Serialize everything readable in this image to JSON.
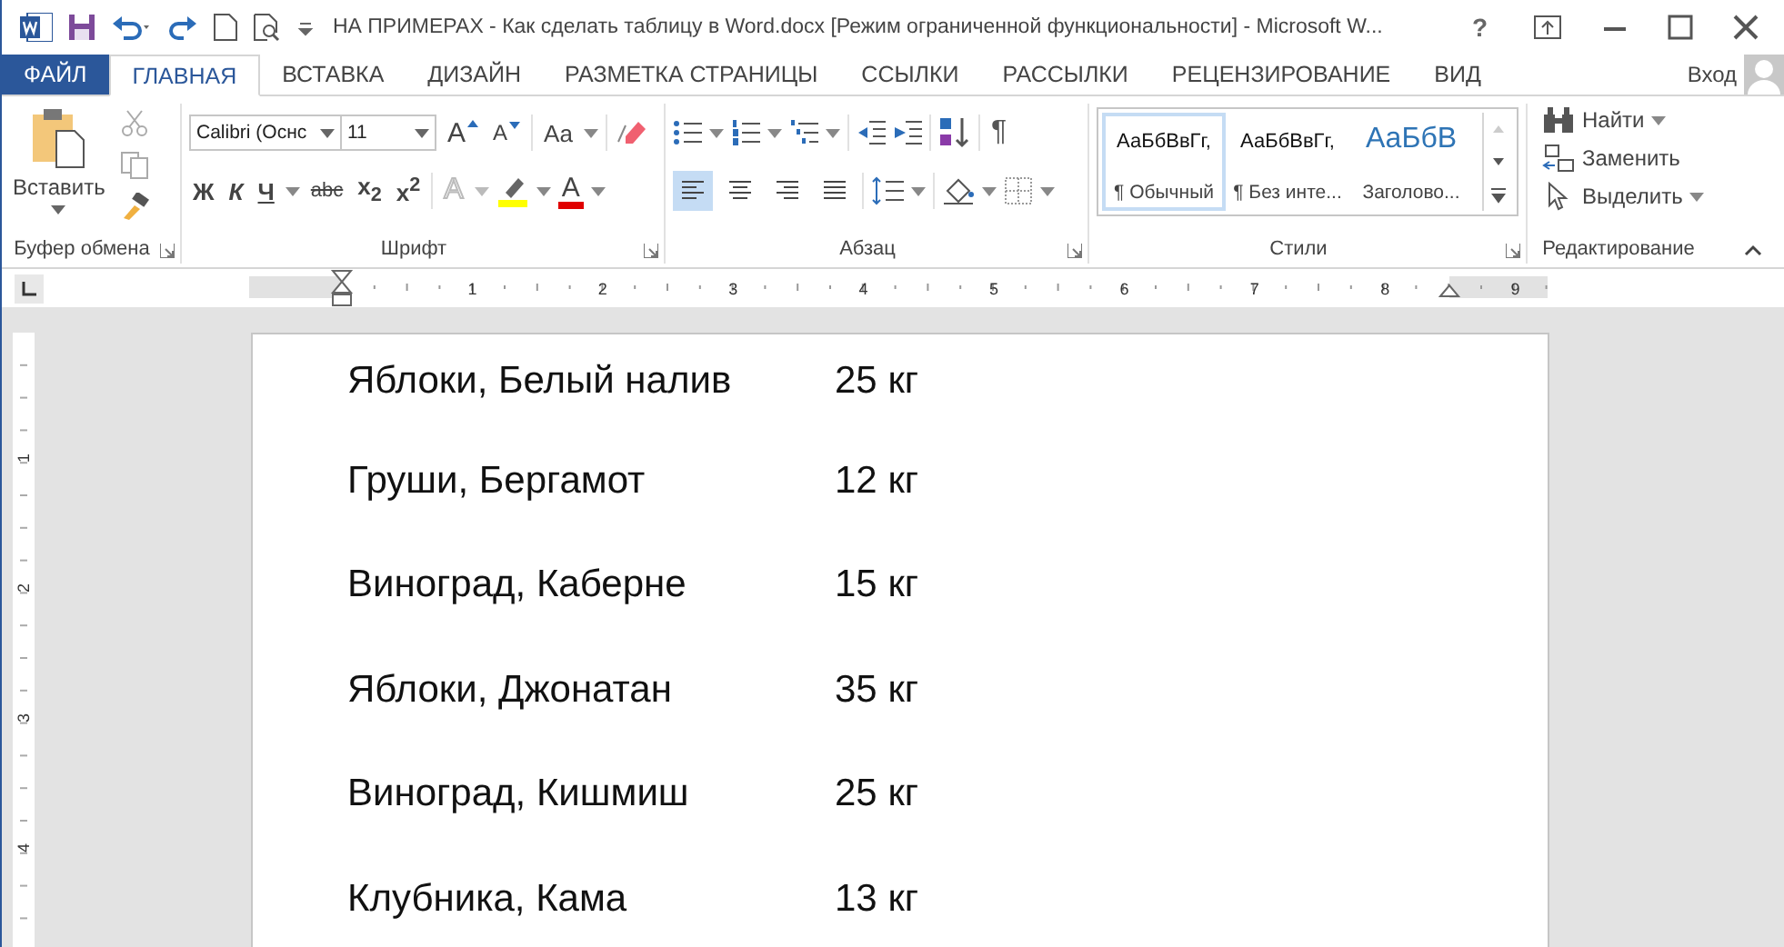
{
  "title_bar": {
    "title": "НА ПРИМЕРАХ - Как сделать таблицу в Word.docx [Режим ограниченной функциональности] - Microsoft W...",
    "help": "?"
  },
  "tabs": [
    {
      "label": "ФАЙЛ",
      "kind": "file",
      "selected": false
    },
    {
      "label": "ГЛАВНАЯ",
      "kind": "tab",
      "selected": true
    },
    {
      "label": "ВСТАВКА",
      "kind": "tab",
      "selected": false
    },
    {
      "label": "ДИЗАЙН",
      "kind": "tab",
      "selected": false
    },
    {
      "label": "РАЗМЕТКА СТРАНИЦЫ",
      "kind": "tab",
      "selected": false
    },
    {
      "label": "ССЫЛКИ",
      "kind": "tab",
      "selected": false
    },
    {
      "label": "РАССЫЛКИ",
      "kind": "tab",
      "selected": false
    },
    {
      "label": "РЕЦЕНЗИРОВАНИЕ",
      "kind": "tab",
      "selected": false
    },
    {
      "label": "ВИД",
      "kind": "tab",
      "selected": false
    }
  ],
  "account": {
    "label": "Вход"
  },
  "clipboard": {
    "paste": "Вставить",
    "label": "Буфер обмена"
  },
  "font": {
    "name": "Calibri (Оснс",
    "size": "11",
    "grow": "A",
    "shrink": "A",
    "case": "Aa",
    "bold": "Ж",
    "italic": "К",
    "underline": "Ч",
    "strike": "abc",
    "subscript": "x$_{2}$",
    "superscript": "x$^{2}$",
    "effects": "A",
    "color_letter": "A",
    "label": "Шрифт"
  },
  "paragraph": {
    "pilcrow": "¶",
    "alignments": [
      {
        "kind": "left",
        "selected": true
      },
      {
        "kind": "center",
        "selected": false
      },
      {
        "kind": "right",
        "selected": false
      },
      {
        "kind": "justify",
        "selected": false
      }
    ],
    "label": "Абзац"
  },
  "styles": {
    "items": [
      {
        "preview": "АаБбВвГг,",
        "name": "¶ Обычный",
        "kind": "normal",
        "selected": true
      },
      {
        "preview": "АаБбВвГг,",
        "name": "¶ Без инте...",
        "kind": "normal",
        "selected": false
      },
      {
        "preview": "АаБбВ",
        "name": "Заголово...",
        "kind": "heading",
        "selected": false
      }
    ],
    "label": "Стили"
  },
  "editing": {
    "items": [
      {
        "kind": "find",
        "label": "Найти"
      },
      {
        "kind": "replace",
        "label": "Заменить"
      },
      {
        "kind": "select",
        "label": "Выделить"
      }
    ],
    "label": "Редактирование"
  },
  "ruler": {
    "numbers": [
      "1",
      "2",
      "3",
      "4",
      "5",
      "6",
      "7",
      "8",
      "9"
    ]
  },
  "vertical_ruler": {
    "numbers": [
      "1",
      "2",
      "3",
      "4"
    ]
  },
  "document": {
    "rows": [
      {
        "item": "Яблоки, Белый налив",
        "qty": "25 кг"
      },
      {
        "item": "Груши, Бергамот",
        "qty": "12 кг"
      },
      {
        "item": "Виноград, Каберне",
        "qty": "15 кг"
      },
      {
        "item": "Яблоки, Джонатан",
        "qty": "35 кг"
      },
      {
        "item": "Виноград, Кишмиш",
        "qty": "25 кг"
      },
      {
        "item": "Клубника, Кама",
        "qty": "13 кг"
      }
    ]
  }
}
